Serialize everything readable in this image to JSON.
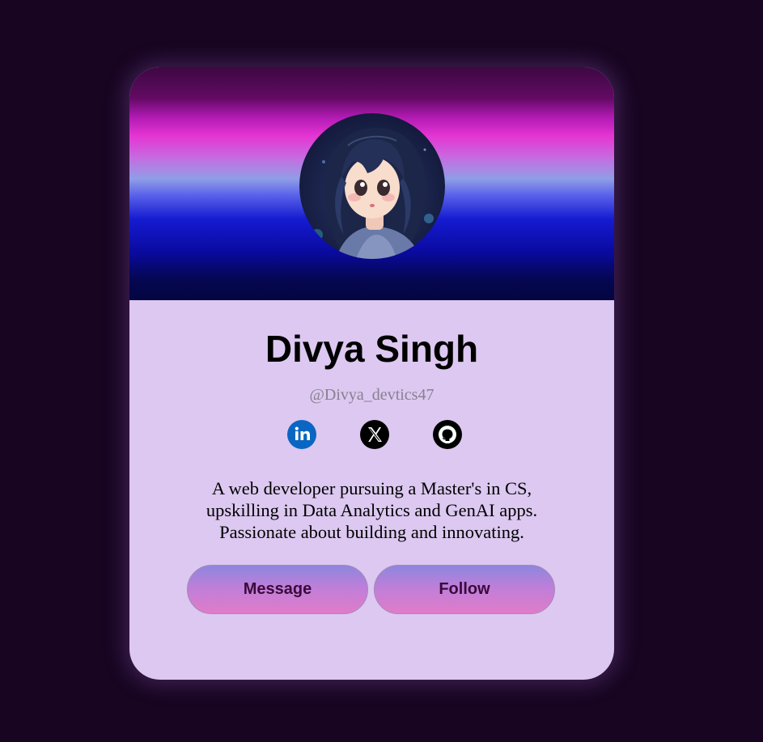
{
  "profile": {
    "name": "Divya Singh",
    "handle": "@Divya_devtics47",
    "bio_lines": [
      "A web developer pursuing a Master's in CS,",
      "upskilling in Data Analytics and GenAI apps.",
      "Passionate about building and innovating."
    ]
  },
  "social": [
    {
      "network": "LinkedIn",
      "icon": "linkedin-icon",
      "color": "#0a66c2"
    },
    {
      "network": "X",
      "icon": "x-icon",
      "color": "#000000"
    },
    {
      "network": "GitHub",
      "icon": "github-icon",
      "color": "#000000"
    }
  ],
  "actions": {
    "message_label": "Message",
    "follow_label": "Follow"
  },
  "colors": {
    "page_background": "#170521",
    "card_background": "#dcc8f0",
    "button_text": "#3a0a3a",
    "handle_text": "#8a8090"
  }
}
